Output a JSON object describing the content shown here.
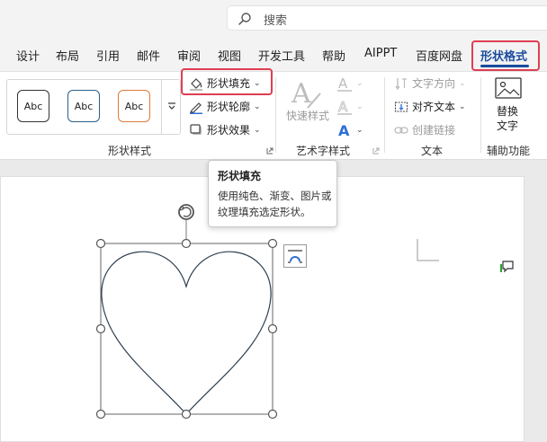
{
  "search": {
    "placeholder": "搜索"
  },
  "tabs": [
    {
      "label": "设计"
    },
    {
      "label": "布局"
    },
    {
      "label": "引用"
    },
    {
      "label": "邮件"
    },
    {
      "label": "审阅"
    },
    {
      "label": "视图"
    },
    {
      "label": "开发工具"
    },
    {
      "label": "帮助"
    },
    {
      "label": "AIPPT"
    },
    {
      "label": "百度网盘"
    },
    {
      "label": "形状格式",
      "active": true
    }
  ],
  "shape_styles": {
    "presets": [
      {
        "label": "Abc",
        "border": "#333333"
      },
      {
        "label": "Abc",
        "border": "#2e5f8a"
      },
      {
        "label": "Abc",
        "border": "#e07b39"
      }
    ],
    "fill_label": "形状填充",
    "outline_label": "形状轮廓",
    "effects_label": "形状效果",
    "group_label": "形状样式"
  },
  "wordart": {
    "quick_styles_label": "快速样式",
    "group_label": "艺术字样式"
  },
  "text_group": {
    "direction_label": "文字方向",
    "align_label": "对齐文本",
    "link_label": "创建链接",
    "group_label": "文本"
  },
  "accessibility": {
    "alt_text_line1": "替换",
    "alt_text_line2": "文字",
    "group_label": "辅助功能"
  },
  "tooltip": {
    "title": "形状填充",
    "body": "使用纯色、渐变、图片或纹理填充选定形状。"
  },
  "colors": {
    "accent": "#1a4c9e",
    "highlight": "#e03e52",
    "wordart_blue": "#2f6fd6",
    "shape_stroke": "#2e3e50"
  }
}
